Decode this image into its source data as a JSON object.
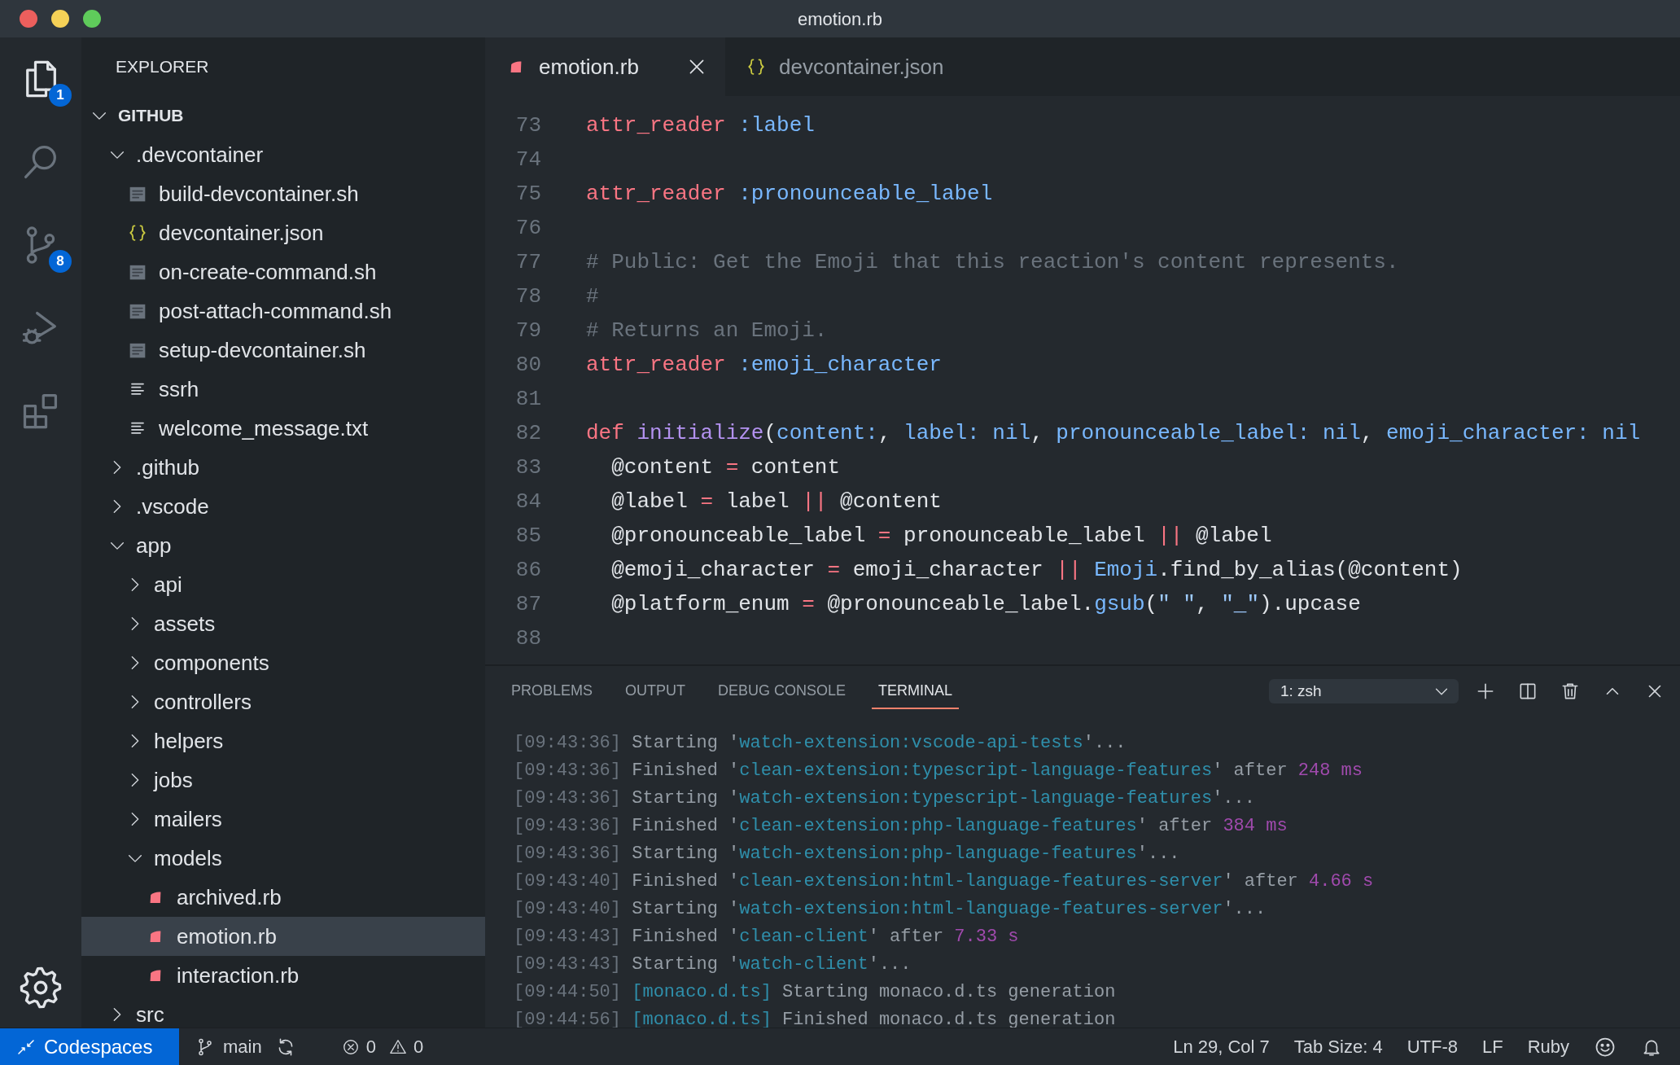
{
  "window": {
    "title": "emotion.rb"
  },
  "activity_bar": {
    "items": [
      {
        "kind": "files",
        "selected": true,
        "badge": "1"
      },
      {
        "kind": "search",
        "selected": false
      },
      {
        "kind": "source-control",
        "selected": false,
        "badge": "8"
      },
      {
        "kind": "run",
        "selected": false
      },
      {
        "kind": "extensions",
        "selected": false
      }
    ]
  },
  "sidebar": {
    "title": "EXPLORER",
    "tree": {
      "label": "GITHUB",
      "kind": "section",
      "expanded": true,
      "selected": false,
      "children": [
        {
          "label": ".devcontainer",
          "kind": "folder",
          "expanded": true,
          "selected": false,
          "children": [
            {
              "label": "build-devcontainer.sh",
              "kind": "shell",
              "selected": false
            },
            {
              "label": "devcontainer.json",
              "kind": "json",
              "selected": false
            },
            {
              "label": "on-create-command.sh",
              "kind": "shell",
              "selected": false
            },
            {
              "label": "post-attach-command.sh",
              "kind": "shell",
              "selected": false
            },
            {
              "label": "setup-devcontainer.sh",
              "kind": "shell",
              "selected": false
            },
            {
              "label": "ssrh",
              "kind": "text",
              "selected": false
            },
            {
              "label": "welcome_message.txt",
              "kind": "text",
              "selected": false
            }
          ]
        },
        {
          "label": ".github",
          "kind": "folder",
          "expanded": false,
          "selected": false
        },
        {
          "label": ".vscode",
          "kind": "folder",
          "expanded": false,
          "selected": false
        },
        {
          "label": "app",
          "kind": "folder",
          "expanded": true,
          "selected": false,
          "children": [
            {
              "label": "api",
              "kind": "folder",
              "expanded": false,
              "selected": false
            },
            {
              "label": "assets",
              "kind": "folder",
              "expanded": false,
              "selected": false
            },
            {
              "label": "components",
              "kind": "folder",
              "expanded": false,
              "selected": false
            },
            {
              "label": "controllers",
              "kind": "folder",
              "expanded": false,
              "selected": false
            },
            {
              "label": "helpers",
              "kind": "folder",
              "expanded": false,
              "selected": false
            },
            {
              "label": "jobs",
              "kind": "folder",
              "expanded": false,
              "selected": false
            },
            {
              "label": "mailers",
              "kind": "folder",
              "expanded": false,
              "selected": false
            },
            {
              "label": "models",
              "kind": "folder",
              "expanded": true,
              "selected": false,
              "children": [
                {
                  "label": "archived.rb",
                  "kind": "ruby",
                  "selected": false
                },
                {
                  "label": "emotion.rb",
                  "kind": "ruby",
                  "selected": true
                },
                {
                  "label": "interaction.rb",
                  "kind": "ruby",
                  "selected": false
                }
              ]
            }
          ]
        },
        {
          "label": "src",
          "kind": "folder",
          "expanded": false,
          "selected": false
        }
      ]
    }
  },
  "editor": {
    "tabs": [
      {
        "label": "emotion.rb",
        "kind": "ruby",
        "selected": true
      },
      {
        "label": "devcontainer.json",
        "kind": "json",
        "selected": false
      }
    ],
    "lines": [
      {
        "number": "73",
        "tokens": [
          {
            "kind": "keyword",
            "text": "attr_reader "
          },
          {
            "kind": "symbol",
            "text": ":label"
          }
        ]
      },
      {
        "number": "74"
      },
      {
        "number": "75",
        "tokens": [
          {
            "kind": "keyword",
            "text": "attr_reader "
          },
          {
            "kind": "symbol",
            "text": ":pronounceable_label"
          }
        ]
      },
      {
        "number": "76"
      },
      {
        "number": "77",
        "tokens": [
          {
            "kind": "comment",
            "text": "# Public: Get the Emoji that this reaction's content represents."
          }
        ]
      },
      {
        "number": "78",
        "tokens": [
          {
            "kind": "comment",
            "text": "#"
          }
        ]
      },
      {
        "number": "79",
        "tokens": [
          {
            "kind": "comment",
            "text": "# Returns an Emoji."
          }
        ]
      },
      {
        "number": "80",
        "tokens": [
          {
            "kind": "keyword",
            "text": "attr_reader "
          },
          {
            "kind": "symbol",
            "text": ":emoji_character"
          }
        ]
      },
      {
        "number": "81"
      },
      {
        "number": "82",
        "tokens": [
          {
            "kind": "keyword",
            "text": "def "
          },
          {
            "kind": "function",
            "text": "initialize"
          },
          {
            "kind": "plain",
            "text": "("
          },
          {
            "kind": "symbol",
            "text": "content:"
          },
          {
            "kind": "plain",
            "text": ", "
          },
          {
            "kind": "symbol",
            "text": "label: nil"
          },
          {
            "kind": "plain",
            "text": ", "
          },
          {
            "kind": "symbol",
            "text": "pronounceable_label: nil"
          },
          {
            "kind": "plain",
            "text": ", "
          },
          {
            "kind": "symbol",
            "text": "emoji_character: nil"
          }
        ]
      },
      {
        "number": "83",
        "tokens": [
          {
            "kind": "plain",
            "text": "  @content "
          },
          {
            "kind": "operator",
            "text": "="
          },
          {
            "kind": "plain",
            "text": " content"
          }
        ]
      },
      {
        "number": "84",
        "tokens": [
          {
            "kind": "plain",
            "text": "  @label "
          },
          {
            "kind": "operator",
            "text": "="
          },
          {
            "kind": "plain",
            "text": " label "
          },
          {
            "kind": "operator",
            "text": "||"
          },
          {
            "kind": "plain",
            "text": " @content"
          }
        ]
      },
      {
        "number": "85",
        "tokens": [
          {
            "kind": "plain",
            "text": "  @pronounceable_label "
          },
          {
            "kind": "operator",
            "text": "="
          },
          {
            "kind": "plain",
            "text": " pronounceable_label "
          },
          {
            "kind": "operator",
            "text": "||"
          },
          {
            "kind": "plain",
            "text": " @label"
          }
        ]
      },
      {
        "number": "86",
        "tokens": [
          {
            "kind": "plain",
            "text": "  @emoji_character "
          },
          {
            "kind": "operator",
            "text": "="
          },
          {
            "kind": "plain",
            "text": " emoji_character "
          },
          {
            "kind": "operator",
            "text": "||"
          },
          {
            "kind": "symbol",
            "text": " Emoji"
          },
          {
            "kind": "plain",
            "text": ".find_by_alias(@content)"
          }
        ]
      },
      {
        "number": "87",
        "tokens": [
          {
            "kind": "plain",
            "text": "  @platform_enum "
          },
          {
            "kind": "operator",
            "text": "="
          },
          {
            "kind": "plain",
            "text": " @pronounceable_label."
          },
          {
            "kind": "symbol",
            "text": "gsub"
          },
          {
            "kind": "plain",
            "text": "("
          },
          {
            "kind": "string",
            "text": "\" \""
          },
          {
            "kind": "plain",
            "text": ", "
          },
          {
            "kind": "string",
            "text": "\"_\""
          },
          {
            "kind": "plain",
            "text": ").upcase"
          }
        ]
      },
      {
        "number": "88"
      }
    ]
  },
  "panel": {
    "tabs": [
      {
        "label": "PROBLEMS",
        "selected": false
      },
      {
        "label": "OUTPUT",
        "selected": false
      },
      {
        "label": "DEBUG CONSOLE",
        "selected": false
      },
      {
        "label": "TERMINAL",
        "selected": true
      }
    ],
    "terminal_select": "1: zsh",
    "lines": [
      [
        {
          "kind": "time",
          "text": "[09:43:36]"
        },
        {
          "kind": "plain",
          "text": " Starting '"
        },
        {
          "kind": "string",
          "text": "watch-extension:vscode-api-tests"
        },
        {
          "kind": "plain",
          "text": "'..."
        }
      ],
      [
        {
          "kind": "time",
          "text": "[09:43:36]"
        },
        {
          "kind": "plain",
          "text": " Finished '"
        },
        {
          "kind": "string",
          "text": "clean-extension:typescript-language-features"
        },
        {
          "kind": "plain",
          "text": "' after "
        },
        {
          "kind": "number",
          "text": "248 ms"
        }
      ],
      [
        {
          "kind": "time",
          "text": "[09:43:36]"
        },
        {
          "kind": "plain",
          "text": " Starting '"
        },
        {
          "kind": "string",
          "text": "watch-extension:typescript-language-features"
        },
        {
          "kind": "plain",
          "text": "'..."
        }
      ],
      [
        {
          "kind": "time",
          "text": "[09:43:36]"
        },
        {
          "kind": "plain",
          "text": " Finished '"
        },
        {
          "kind": "string",
          "text": "clean-extension:php-language-features"
        },
        {
          "kind": "plain",
          "text": "' after "
        },
        {
          "kind": "number",
          "text": "384 ms"
        }
      ],
      [
        {
          "kind": "time",
          "text": "[09:43:36]"
        },
        {
          "kind": "plain",
          "text": " Starting '"
        },
        {
          "kind": "string",
          "text": "watch-extension:php-language-features"
        },
        {
          "kind": "plain",
          "text": "'..."
        }
      ],
      [
        {
          "kind": "time",
          "text": "[09:43:40]"
        },
        {
          "kind": "plain",
          "text": " Finished '"
        },
        {
          "kind": "string",
          "text": "clean-extension:html-language-features-server"
        },
        {
          "kind": "plain",
          "text": "' after "
        },
        {
          "kind": "number",
          "text": "4.66 s"
        }
      ],
      [
        {
          "kind": "time",
          "text": "[09:43:40]"
        },
        {
          "kind": "plain",
          "text": " Starting '"
        },
        {
          "kind": "string",
          "text": "watch-extension:html-language-features-server"
        },
        {
          "kind": "plain",
          "text": "'..."
        }
      ],
      [
        {
          "kind": "time",
          "text": "[09:43:43]"
        },
        {
          "kind": "plain",
          "text": " Finished '"
        },
        {
          "kind": "string",
          "text": "clean-client"
        },
        {
          "kind": "plain",
          "text": "' after "
        },
        {
          "kind": "number",
          "text": "7.33 s"
        }
      ],
      [
        {
          "kind": "time",
          "text": "[09:43:43]"
        },
        {
          "kind": "plain",
          "text": " Starting '"
        },
        {
          "kind": "string",
          "text": "watch-client"
        },
        {
          "kind": "plain",
          "text": "'..."
        }
      ],
      [
        {
          "kind": "time",
          "text": "[09:44:50] "
        },
        {
          "kind": "string",
          "text": "[monaco.d.ts]"
        },
        {
          "kind": "plain",
          "text": " Starting monaco.d.ts generation"
        }
      ],
      [
        {
          "kind": "time",
          "text": "[09:44:56] "
        },
        {
          "kind": "string",
          "text": "[monaco.d.ts]"
        },
        {
          "kind": "plain",
          "text": " Finished monaco.d.ts generation"
        }
      ]
    ]
  },
  "status_bar": {
    "remote": "Codespaces",
    "branch": "main",
    "errors": "0",
    "warnings": "0",
    "items": [
      "Ln 29, Col 7",
      "Tab Size: 4",
      "UTF-8",
      "LF",
      "Ruby"
    ]
  }
}
